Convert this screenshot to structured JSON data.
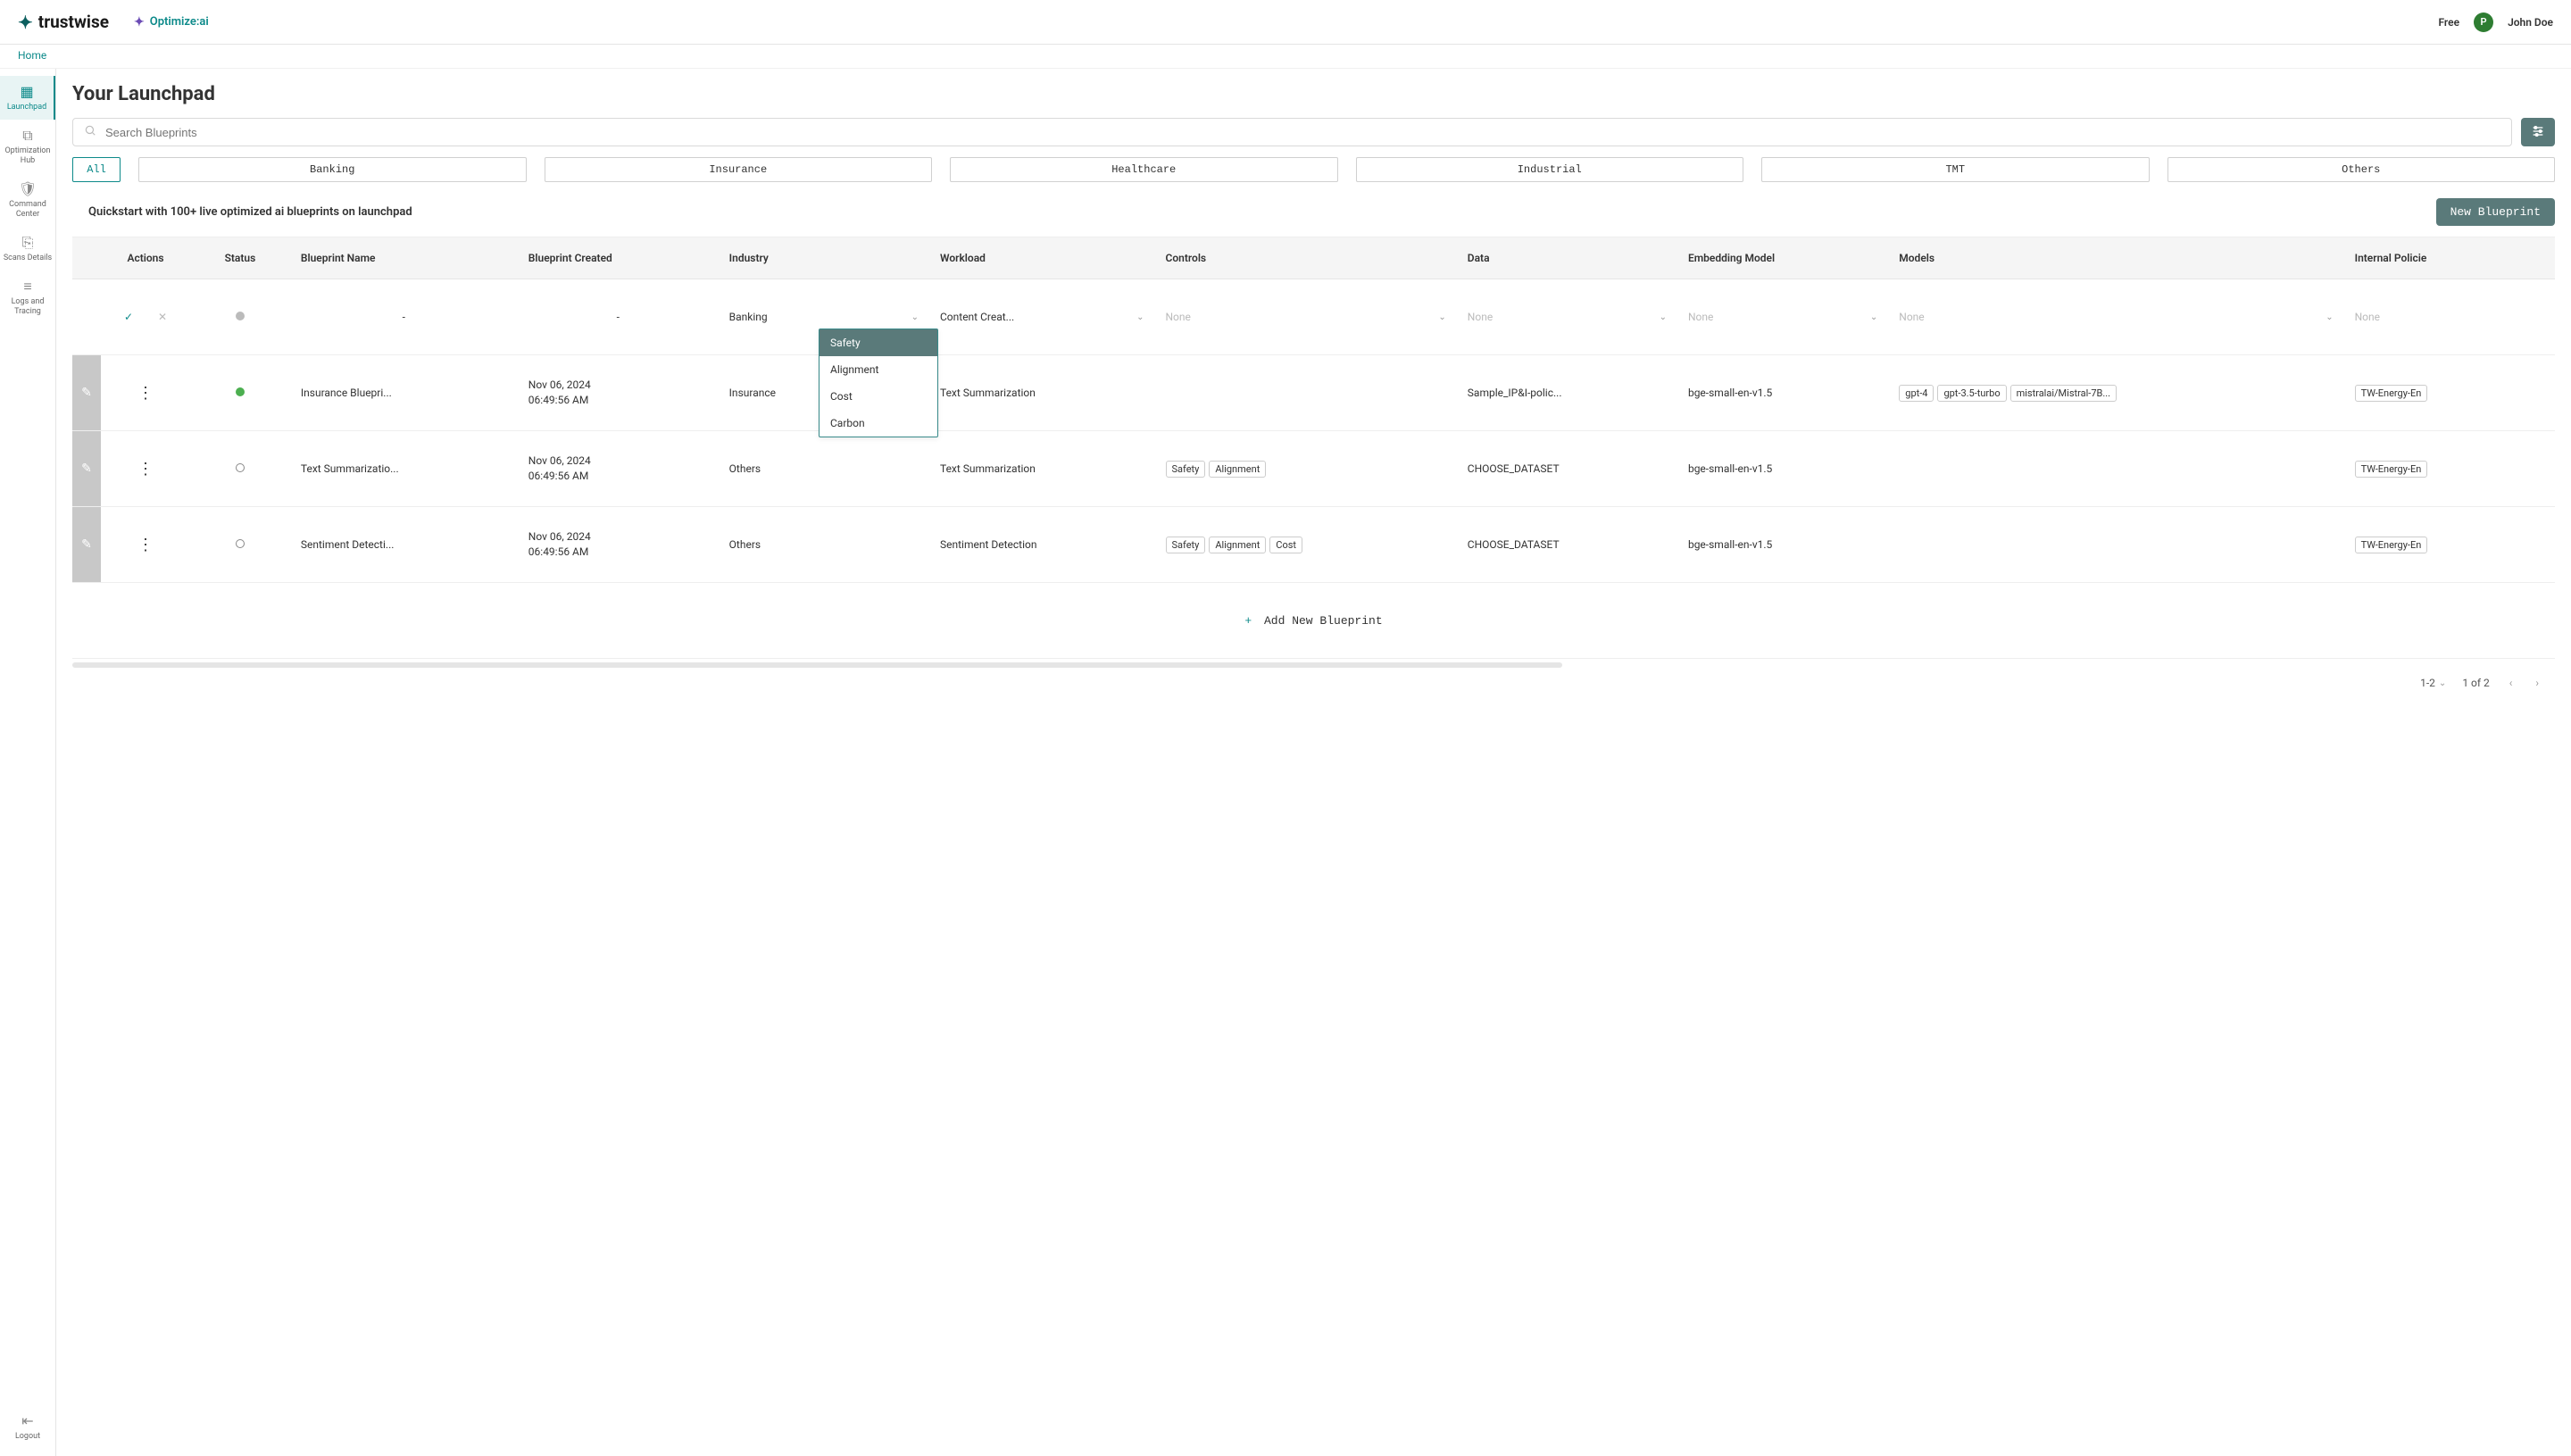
{
  "brand": "trustwise",
  "optimize_label": "Optimize:ai",
  "plan_label": "Free",
  "user_initial": "P",
  "user_name": "John Doe",
  "breadcrumb_home": "Home",
  "sidebar": {
    "launchpad": "Launchpad",
    "optimization_hub": "Optimization Hub",
    "command_center": "Command Center",
    "scans_details": "Scans Details",
    "logs_tracing": "Logs and Tracing",
    "logout": "Logout"
  },
  "page_title": "Your Launchpad",
  "search_placeholder": "Search Blueprints",
  "categories": [
    "All",
    "Banking",
    "Insurance",
    "Healthcare",
    "Industrial",
    "TMT",
    "Others"
  ],
  "quickstart_text": "Quickstart with 100+ live optimized ai blueprints on launchpad",
  "new_blueprint_label": "New Blueprint",
  "columns": {
    "actions": "Actions",
    "status": "Status",
    "name": "Blueprint Name",
    "created": "Blueprint Created",
    "industry": "Industry",
    "workload": "Workload",
    "controls": "Controls",
    "data": "Data",
    "embedding": "Embedding Model",
    "models": "Models",
    "policies": "Internal Policie"
  },
  "new_row": {
    "industry": "Banking",
    "workload": "Content Creat...",
    "controls_placeholder": "None",
    "data_placeholder": "None",
    "embedding_placeholder": "None",
    "models_placeholder": "None",
    "policies_placeholder": "None"
  },
  "controls_dropdown": [
    "Safety",
    "Alignment",
    "Cost",
    "Carbon"
  ],
  "rows": [
    {
      "name": "Insurance Bluepri...",
      "created_date": "Nov 06, 2024",
      "created_time": "06:49:56 AM",
      "industry": "Insurance",
      "workload": "Text Summarization",
      "controls": [],
      "data": "Sample_IP&I-polic...",
      "embedding": "bge-small-en-v1.5",
      "models": [
        "gpt-4",
        "gpt-3.5-turbo",
        "mistralai/Mistral-7B..."
      ],
      "policies": "TW-Energy-En",
      "status": "green"
    },
    {
      "name": "Text Summarizatio...",
      "created_date": "Nov 06, 2024",
      "created_time": "06:49:56 AM",
      "industry": "Others",
      "workload": "Text Summarization",
      "controls": [
        "Safety",
        "Alignment"
      ],
      "data": "CHOOSE_DATASET",
      "embedding": "bge-small-en-v1.5",
      "models": [],
      "policies": "TW-Energy-En",
      "status": "outline"
    },
    {
      "name": "Sentiment Detecti...",
      "created_date": "Nov 06, 2024",
      "created_time": "06:49:56 AM",
      "industry": "Others",
      "workload": "Sentiment Detection",
      "controls": [
        "Safety",
        "Alignment",
        "Cost"
      ],
      "data": "CHOOSE_DATASET",
      "embedding": "bge-small-en-v1.5",
      "models": [],
      "policies": "TW-Energy-En",
      "status": "outline"
    }
  ],
  "add_blueprint_label": "Add New Blueprint",
  "pagination": {
    "range": "1-2",
    "page_info": "1 of 2"
  }
}
